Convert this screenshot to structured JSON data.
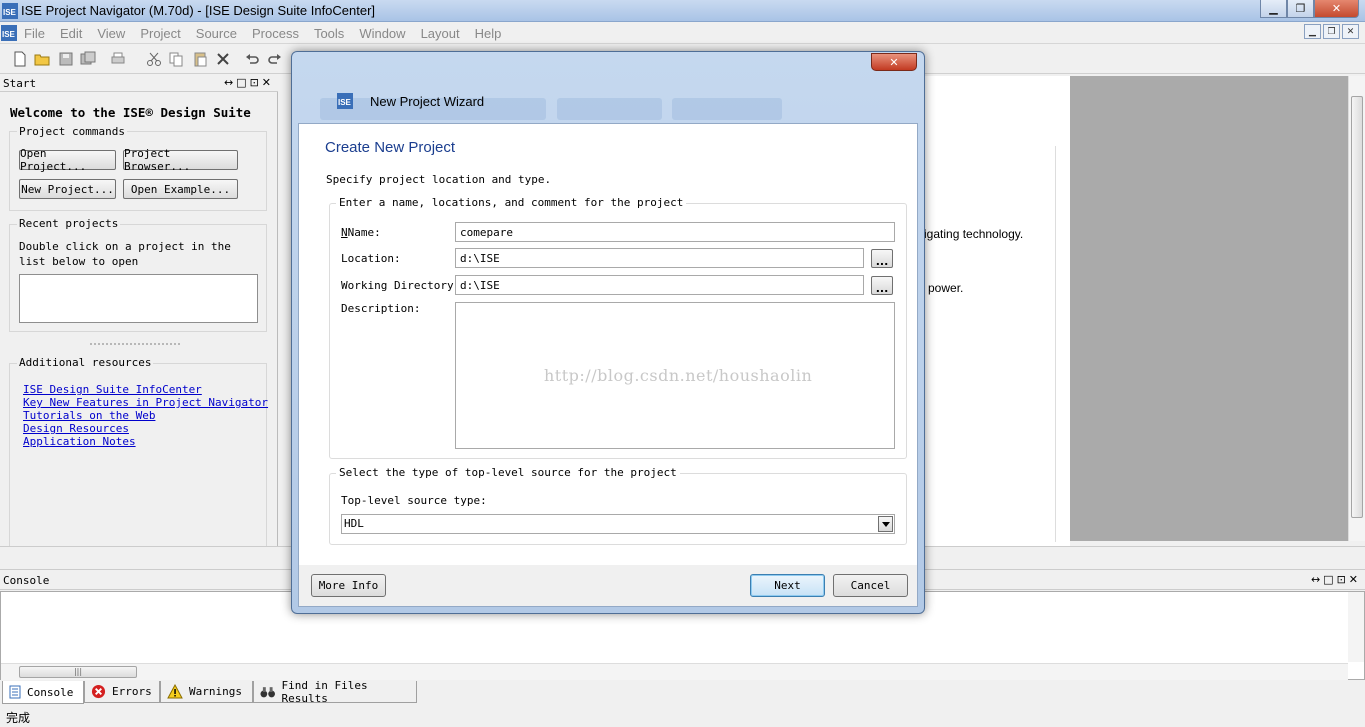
{
  "window": {
    "title": "ISE Project Navigator (M.70d) - [ISE Design Suite InfoCenter]"
  },
  "menu": {
    "items": [
      "File",
      "Edit",
      "View",
      "Project",
      "Source",
      "Process",
      "Tools",
      "Window",
      "Layout",
      "Help"
    ]
  },
  "start_panel": {
    "title": "Start",
    "welcome": "Welcome to the ISE® Design Suite",
    "project_commands": {
      "title": "Project commands",
      "open_project": "Open Project...",
      "project_browser": "Project Browser...",
      "new_project": "New Project...",
      "open_example": "Open Example..."
    },
    "recent": {
      "title": "Recent projects",
      "hint": "Double click on a project in the list below to open"
    },
    "resources": {
      "title": "Additional resources",
      "links": [
        "ISE Design Suite InfoCenter",
        "Key New Features in Project Navigator",
        "Tutorials on the Web",
        "Design Resources",
        "Application Notes"
      ]
    }
  },
  "background_doc": {
    "line1": "igating technology.",
    "line2": "power."
  },
  "dialog": {
    "window_title": "New Project Wizard",
    "heading": "Create New Project",
    "description": "Specify project location and type.",
    "group1": {
      "title": "Enter a name, locations, and comment for the project",
      "name_label": "Name:",
      "name_value": "comepare",
      "location_label": "Location:",
      "location_value": "d:\\ISE",
      "workdir_label": "Working Directory:",
      "workdir_value": "d:\\ISE",
      "description_label": "Description:",
      "browse_label": "..."
    },
    "group2": {
      "title": "Select the type of top-level source for the project",
      "source_type_label": "Top-level source type:",
      "source_type_value": "HDL"
    },
    "watermark": "http://blog.csdn.net/houshaolin",
    "buttons": {
      "more_info": "More Info",
      "next": "Next",
      "cancel": "Cancel"
    }
  },
  "console": {
    "title": "Console",
    "tabs": [
      "Console",
      "Errors",
      "Warnings",
      "Find in Files Results"
    ]
  },
  "status": {
    "text": "完成"
  }
}
